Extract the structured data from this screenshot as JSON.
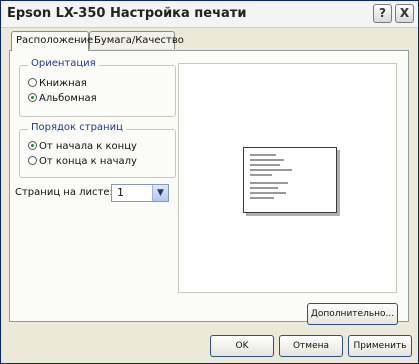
{
  "window": {
    "title": "Epson LX-350 Настройка печати",
    "help_button": "?",
    "close_button": "X"
  },
  "tabs": [
    {
      "label": "Расположение",
      "active": true
    },
    {
      "label": "Бумага/Качество",
      "active": false
    }
  ],
  "orientation": {
    "legend": "Ориентация",
    "options": [
      {
        "label": "Книжная",
        "selected": false
      },
      {
        "label": "Альбомная",
        "selected": true
      }
    ]
  },
  "page_order": {
    "legend": "Порядок страниц",
    "options": [
      {
        "label": "От начала к концу",
        "selected": true
      },
      {
        "label": "От конца к началу",
        "selected": false
      }
    ]
  },
  "pages_per_sheet": {
    "label": "Страниц на листе:",
    "value": "1"
  },
  "buttons": {
    "advanced": "Дополнительно...",
    "ok": "OK",
    "cancel": "Отмена",
    "apply": "Применить"
  }
}
